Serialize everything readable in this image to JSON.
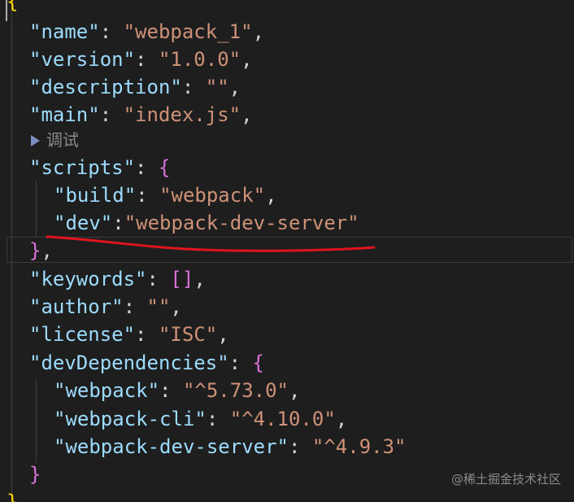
{
  "codelens": {
    "label": "调试"
  },
  "punct": {
    "colon": ":",
    "comma": ","
  },
  "json": {
    "open_brace": "{",
    "close_brace": "}",
    "name_key": "\"name\"",
    "name_value": "\"webpack_1\"",
    "version_key": "\"version\"",
    "version_value": "\"1.0.0\"",
    "description_key": "\"description\"",
    "description_value": "\"\"",
    "main_key": "\"main\"",
    "main_value": "\"index.js\"",
    "scripts_key": "\"scripts\"",
    "scripts_open": "{",
    "scripts_close": "}",
    "build_key": "\"build\"",
    "build_value": "\"webpack\"",
    "dev_key": "\"dev\"",
    "dev_value": "\"webpack-dev-server\"",
    "keywords_key": "\"keywords\"",
    "keywords_value": "[]",
    "author_key": "\"author\"",
    "author_value": "\"\"",
    "license_key": "\"license\"",
    "license_value": "\"ISC\"",
    "devDependencies_key": "\"devDependencies\"",
    "devDependencies_open": "{",
    "devDependencies_close": "}",
    "dep_webpack_key": "\"webpack\"",
    "dep_webpack_value": "\"^5.73.0\"",
    "dep_webpack_cli_key": "\"webpack-cli\"",
    "dep_webpack_cli_value": "\"^4.10.0\"",
    "dep_webpack_dev_server_key": "\"webpack-dev-server\"",
    "dep_webpack_dev_server_value": "\"^4.9.3\""
  },
  "annotation": {
    "color": "#e0141e"
  },
  "watermark": {
    "text": "@稀土掘金技术社区"
  },
  "colors": {
    "background": "#1e1e1e",
    "key": "#9cdcfe",
    "string": "#ce9178",
    "bracket_level1": "#ffd700",
    "bracket_level2": "#da70d6",
    "bracket_level3": "#179fff"
  }
}
